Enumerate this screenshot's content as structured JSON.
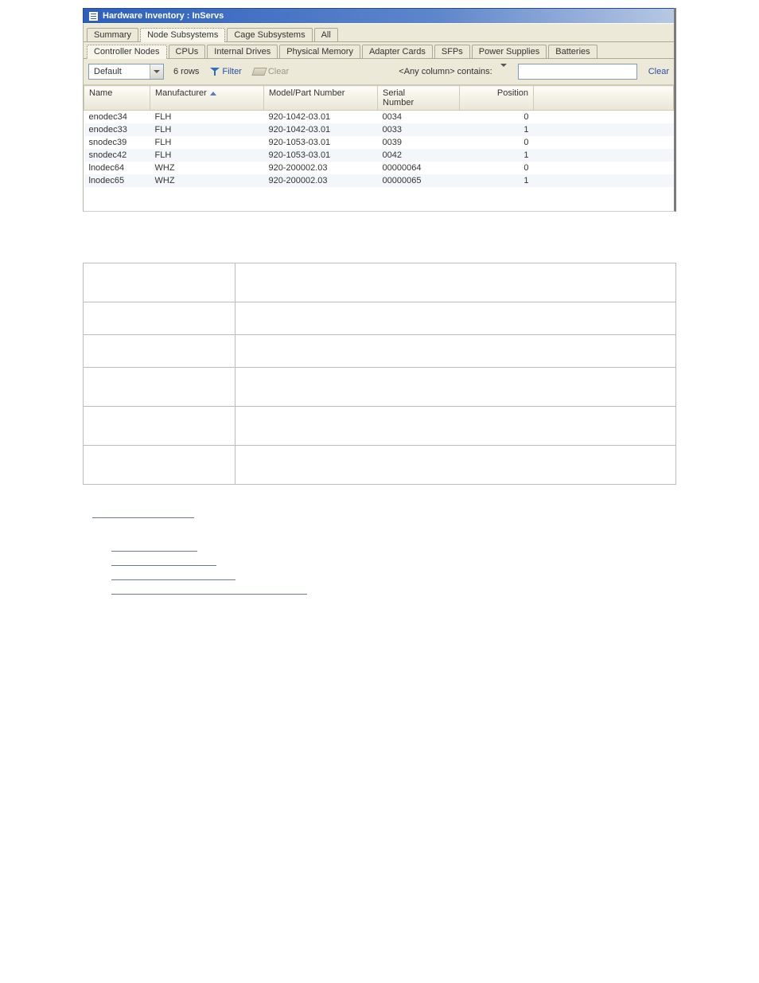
{
  "window": {
    "title": "Hardware Inventory : InServs"
  },
  "mainTabs": {
    "items": [
      {
        "label": "Summary"
      },
      {
        "label": "Node Subsystems"
      },
      {
        "label": "Cage Subsystems"
      },
      {
        "label": "All"
      }
    ],
    "activeIndex": 1
  },
  "subTabs": {
    "items": [
      {
        "label": "Controller Nodes"
      },
      {
        "label": "CPUs"
      },
      {
        "label": "Internal Drives"
      },
      {
        "label": "Physical Memory"
      },
      {
        "label": "Adapter Cards"
      },
      {
        "label": "SFPs"
      },
      {
        "label": "Power Supplies"
      },
      {
        "label": "Batteries"
      }
    ],
    "activeIndex": 0
  },
  "toolbar": {
    "viewSelect": "Default",
    "rowCount": "6 rows",
    "filterLabel": "Filter",
    "clearLabel": "Clear",
    "searchLabel": "<Any column> contains:",
    "searchValue": "",
    "searchClear": "Clear"
  },
  "table": {
    "columns": [
      "Name",
      "Manufacturer",
      "Model/Part Number",
      "Serial Number",
      "Position"
    ],
    "sortColumn": 1,
    "sortDir": "asc",
    "rows": [
      {
        "name": "enodec34",
        "manufacturer": "FLH",
        "model": "920-1042-03.01",
        "serial": "0034",
        "position": "0"
      },
      {
        "name": "enodec33",
        "manufacturer": "FLH",
        "model": "920-1042-03.01",
        "serial": "0033",
        "position": "1"
      },
      {
        "name": "snodec39",
        "manufacturer": "FLH",
        "model": "920-1053-03.01",
        "serial": "0039",
        "position": "0"
      },
      {
        "name": "snodec42",
        "manufacturer": "FLH",
        "model": "920-1053-03.01",
        "serial": "0042",
        "position": "1"
      },
      {
        "name": "lnodec64",
        "manufacturer": "WHZ",
        "model": "920-200002.03",
        "serial": "00000064",
        "position": "0"
      },
      {
        "name": "lnodec65",
        "manufacturer": "WHZ",
        "model": "920-200002.03",
        "serial": "00000065",
        "position": "1"
      }
    ]
  },
  "underlines": [
    128,
    108,
    132,
    156,
    246
  ]
}
